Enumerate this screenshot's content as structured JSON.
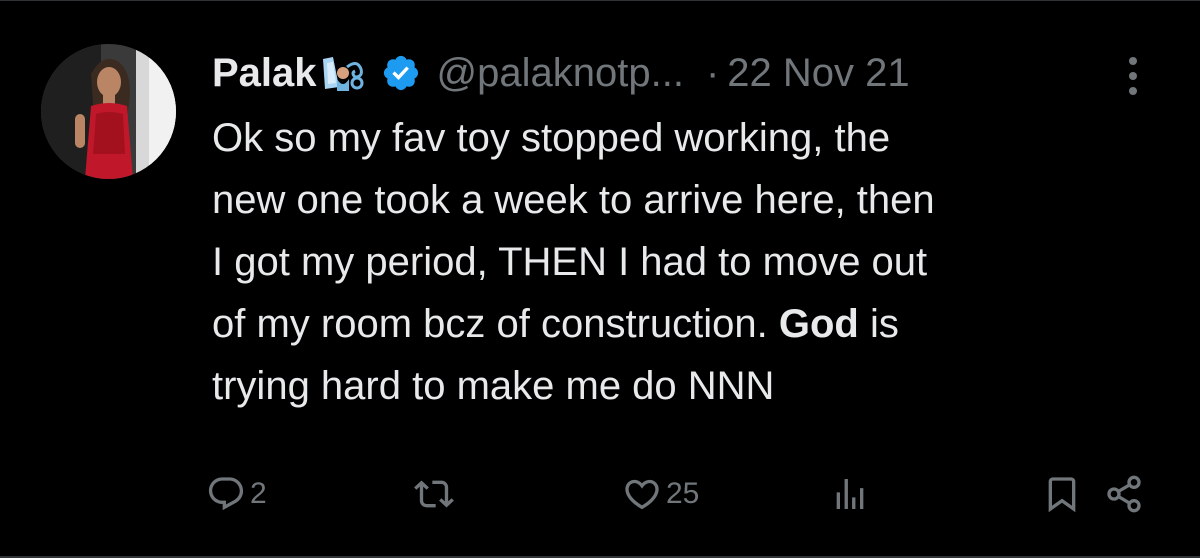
{
  "tweet": {
    "author_name": "Palak",
    "name_emoji_icon": "fairy-emoji-icon",
    "verified_icon": "verified-badge-icon",
    "handle": "@palaknotp...",
    "separator": "·",
    "date": "22 Nov 21",
    "more_icon": "more-vertical-icon",
    "text_lines": [
      [
        "Ok so my fav toy stopped working, the"
      ],
      [
        "new one took a week to arrive here, then"
      ],
      [
        "I got my period, THEN I had to move out"
      ],
      [
        "of my room bcz of construction. ",
        "God",
        " is"
      ],
      [
        "trying hard to make me do NNN"
      ]
    ]
  },
  "actions": {
    "reply": {
      "icon": "reply-icon",
      "count": "2"
    },
    "retweet": {
      "icon": "retweet-icon",
      "count": ""
    },
    "like": {
      "icon": "heart-icon",
      "count": "25"
    },
    "views": {
      "icon": "views-icon",
      "count": ""
    },
    "bookmark": {
      "icon": "bookmark-icon"
    },
    "share": {
      "icon": "share-icon"
    }
  },
  "colors": {
    "background": "#000000",
    "text": "#e7e9ea",
    "secondary": "#71767b",
    "verified": "#1d9bf0",
    "divider": "#2f3336"
  }
}
